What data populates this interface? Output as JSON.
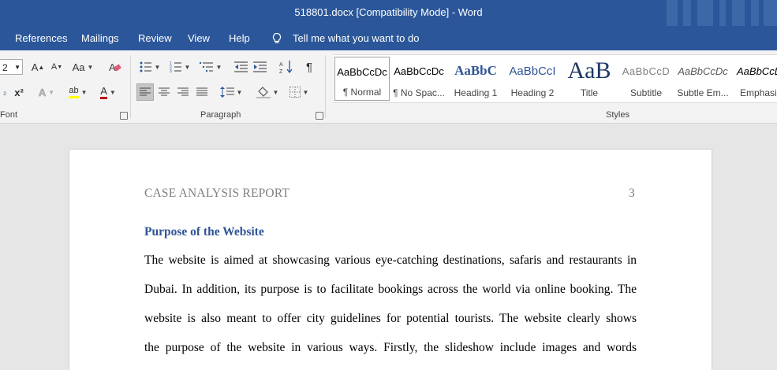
{
  "window": {
    "title": "518801.docx [Compatibility Mode]  -  Word"
  },
  "menu": {
    "items": [
      "References",
      "Mailings",
      "Review",
      "View",
      "Help"
    ],
    "tellme": "Tell me what you want to do"
  },
  "ribbon": {
    "font": {
      "size": "2",
      "group_label": "Font",
      "grow": "A",
      "shrink": "A",
      "change_case": "Aa",
      "subscript": "₂",
      "superscript": "x²",
      "text_effects": "A",
      "highlight": "ab",
      "font_color": "A"
    },
    "paragraph": {
      "group_label": "Paragraph",
      "show_marks": "¶"
    },
    "styles": {
      "group_label": "Styles",
      "items": [
        {
          "sample": "AaBbCcDc",
          "name": "¶ Normal"
        },
        {
          "sample": "AaBbCcDc",
          "name": "¶ No Spac..."
        },
        {
          "sample": "AaBbC",
          "name": "Heading 1"
        },
        {
          "sample": "AaBbCcI",
          "name": "Heading 2"
        },
        {
          "sample": "AaB",
          "name": "Title"
        },
        {
          "sample": "AaBbCcD",
          "name": "Subtitle"
        },
        {
          "sample": "AaBbCcDc",
          "name": "Subtle Em..."
        },
        {
          "sample": "AaBbCcDc",
          "name": "Emphasis"
        }
      ]
    }
  },
  "document": {
    "header_left": "CASE ANALYSIS REPORT",
    "page_number": "3",
    "heading": "Purpose of the Website",
    "lines": [
      "The website is aimed at showcasing various eye-catching destinations, safaris and restaurants in",
      "Dubai. In addition, its purpose is to facilitate bookings across the world via online booking. The",
      "website is also meant to offer city guidelines for potential tourists.  The website clearly shows",
      "the purpose of the website in various ways. Firstly, the slideshow include images and words"
    ]
  },
  "colors": {
    "titlebar": "#2b579a",
    "ribbon": "#f3f3f3",
    "heading": "#2f5496",
    "header_text": "#7f7f7f"
  }
}
